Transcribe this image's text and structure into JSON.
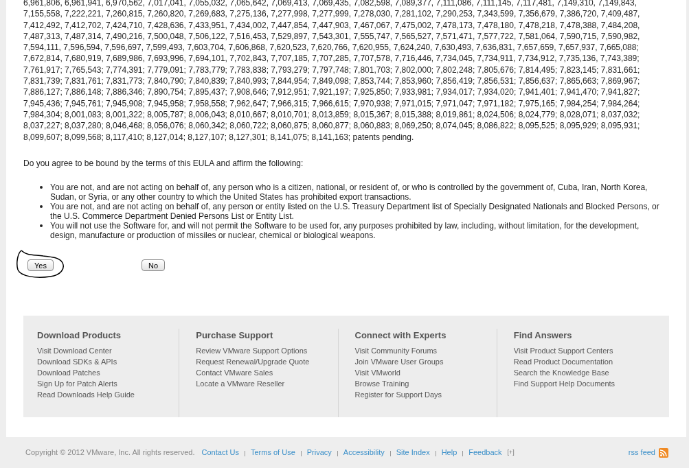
{
  "patent_lines": [
    "6,961,806, 6,961,941, 6,970,562, 7,017,041, 7,055,032, 7,065,642, 7,069,413, 7,069,435, 7,082,598, 7,089,377, 7,111,086, 7,111,145, 7,117,481, 7,149,310, 7,149,843,",
    "7,155,558, 7,222,221, 7,260,815, 7,260,820, 7,269,683, 7,275,136, 7,277,998, 7,277,999, 7,278,030, 7,281,102, 7,290,253, 7,343,599, 7,356,679, 7,386,720, 7,409,487,",
    "7,412,492, 7,412,702, 7,424,710, 7,428,636, 7,433,951, 7,434,002, 7,447,854, 7,447,903, 7,467,067, 7,475,002, 7,478,173, 7,478,180, 7,478,218, 7,478,388, 7,484,208,",
    "7,487,313, 7,487,314, 7,490,216, 7,500,048, 7,506,122, 7,516,453, 7,529,897, 7,543,301, 7,555,747, 7,565,527, 7,571,471, 7,577,722, 7,581,064, 7,590,715, 7,590,982,",
    "7,594,111, 7,596,594, 7,596,697, 7,599,493, 7,603,704, 7,606,868, 7,620,523, 7,620,766, 7,620,955, 7,624,240, 7,630,493, 7,636,831, 7,657,659, 7,657,937, 7,665,088;",
    "7,672,814, 7,680,919, 7,689,986, 7,693,996, 7,694,101, 7,702,843, 7,707,185, 7,707,285, 7,707,578, 7,716,446, 7,734,045, 7,734,911, 7,734,912, 7,735,136, 7,743,389;",
    "7,761,917; 7,765,543; 7,774,391; 7,779,091; 7,783,779; 7,783,838; 7,793,279; 7,797,748; 7,801,703; 7,802,000; 7,802,248; 7,805,676; 7,814,495; 7,823,145; 7,831,661;",
    "7,831,739; 7,831,761; 7,831,773; 7,840,790; 7,840,839; 7,840,993; 7,844,954; 7,849,098; 7,853,744; 7,853,960; 7,856,419; 7,856,531; 7,856,637; 7,865,663; 7,869,967;",
    "7,886,127; 7,886,148; 7,886,346; 7,890,754; 7,895,437; 7,908,646; 7,912,951; 7,921,197; 7,925,850; 7,933,981; 7,934,017; 7,934,020; 7,941,401; 7,941,470; 7,941,827;",
    "7,945,436; 7,945,761; 7,945,908; 7,945,958; 7,958,558; 7,962,647; 7,966,315; 7,966,615; 7,970,938; 7,971,015; 7,971,047; 7,971,182; 7,975,165; 7,984,254; 7,984,264;",
    "7,984,304; 8,001,083; 8,001,322; 8,005,787; 8,006,043; 8,010,667; 8,010,701; 8,013,859; 8,015,367; 8,015,388; 8,019,861; 8,024,506; 8,024,779; 8,028,071; 8,037,032;",
    "8,037,227; 8,037,280; 8,046,468; 8,056,076; 8,060,342; 8,060,722; 8,060,875; 8,060,877; 8,060,883; 8,069,250; 8,074,045; 8,086,822; 8,095,525; 8,095,929; 8,095,931;",
    "8,099,607; 8,099,568; 8,117,410; 8,127,014; 8,127,107; 8,127,301; 8,141,075; 8,141,163; patents pending."
  ],
  "question": "Do you agree to be bound by the terms of this EULA and affirm the following:",
  "bullets": [
    "You are not, and are not acting on behalf of, any person who is a citizen, national, or resident of, or who is controlled by the government of, Cuba, Iran, North Korea, Sudan, or Syria, or any other country to which the United States has prohibited export transactions.",
    "You are not, and are not acting on behalf of, any person or entity listed on the U.S. Treasury Department list of Specially Designated Nationals and Blocked Persons, or the U.S. Commerce Department Denied Persons List or Entity List.",
    "You will not use the Software for, and will not permit the Software to be used for, any purposes prohibited by law, including, without limitation, for the development, design, manufacture or production of missiles or nuclear, chemical or biological weapons."
  ],
  "buttons": [
    {
      "label": "Yes",
      "circled": true
    },
    {
      "label": "No",
      "circled": false
    }
  ],
  "footer_columns": [
    {
      "title": "Download Products",
      "links": [
        "Visit Download Center",
        "Download SDKs & APIs",
        "Download Patches",
        "Sign Up for Patch Alerts",
        "Read Downloads Help Guide"
      ]
    },
    {
      "title": "Purchase Support",
      "links": [
        "Review VMware Support Options",
        "Request Renewal/Upgrade Quote",
        "Contact VMware Sales",
        "Locate a VMware Reseller"
      ]
    },
    {
      "title": "Connect with Experts",
      "links": [
        "Visit Community Forums",
        "Join VMware User Groups",
        "Visit VMworld",
        "Browse Training",
        "Register for Support Days"
      ]
    },
    {
      "title": "Find Answers",
      "links": [
        "Visit Product Support Centers",
        "Read Product Documentation",
        "Search the Knowledge Base",
        "Find Support Help Documents"
      ]
    }
  ],
  "bottom_bar": {
    "copyright": "Copyright © 2012 VMware, Inc. All rights reserved.",
    "links": [
      "Contact Us",
      "Terms of Use",
      "Privacy",
      "Accessibility",
      "Site Index",
      "Help",
      "Feedback"
    ],
    "feedback_toggle": "[+]",
    "rss": "rss feed"
  }
}
